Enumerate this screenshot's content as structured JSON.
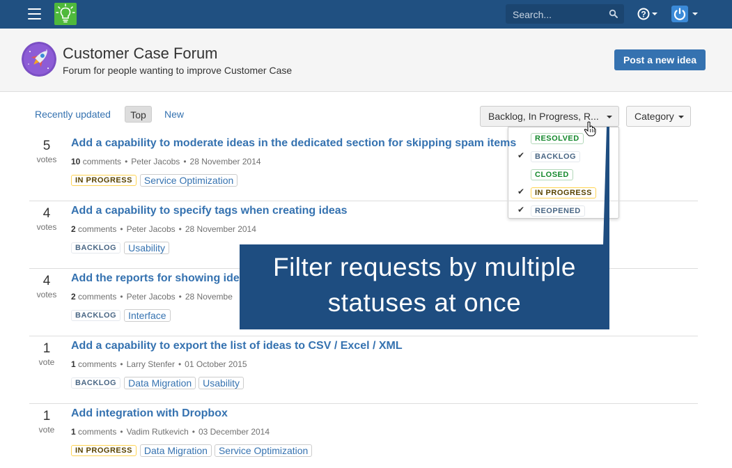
{
  "topbar": {
    "search_placeholder": "Search...",
    "menu_icon": "hamburger-menu-icon",
    "logo_icon": "lightbulb-logo-icon",
    "help_icon": "help-question-icon",
    "user_icon": "power-user-icon",
    "brand_color": "#205081"
  },
  "header": {
    "title": "Customer Case Forum",
    "subtitle": "Forum for people wanting to improve Customer Case",
    "post_button": "Post a new idea",
    "avatar_icon": "rocket-avatar-icon"
  },
  "tabs": {
    "recent": "Recently updated",
    "top": "Top",
    "new": "New",
    "active": "Top"
  },
  "filters": {
    "status_label": "Backlog, In Progress, R...",
    "category_label": "Category"
  },
  "status_dropdown": [
    {
      "label": "RESOLVED",
      "checked": false,
      "color": "green"
    },
    {
      "label": "BACKLOG",
      "checked": true,
      "color": "blue"
    },
    {
      "label": "CLOSED",
      "checked": false,
      "color": "green"
    },
    {
      "label": "IN PROGRESS",
      "checked": true,
      "color": "yellow"
    },
    {
      "label": "REOPENED",
      "checked": true,
      "color": "blue"
    }
  ],
  "check_mark": "✔",
  "ideas": [
    {
      "votes": "5",
      "votes_label": "votes",
      "title": "Add a capability to moderate ideas in the dedicated section for skipping spam items",
      "comments": "10",
      "comments_label": "comments",
      "author": "Peter Jacobs",
      "date": "28 November 2014",
      "status": "IN PROGRESS",
      "status_color": "yellow",
      "tags": [
        "Service Optimization"
      ]
    },
    {
      "votes": "4",
      "votes_label": "votes",
      "title": "Add a capability to specify tags when creating ideas",
      "comments": "2",
      "comments_label": "comments",
      "author": "Peter Jacobs",
      "date": "28 November 2014",
      "status": "BACKLOG",
      "status_color": "blue",
      "tags": [
        "Usability"
      ]
    },
    {
      "votes": "4",
      "votes_label": "votes",
      "title": "Add the reports for showing ide",
      "comments": "2",
      "comments_label": "comments",
      "author": "Peter Jacobs",
      "date": "28 Novembe",
      "status": "BACKLOG",
      "status_color": "blue",
      "tags": [
        "Interface"
      ]
    },
    {
      "votes": "1",
      "votes_label": "vote",
      "title": "Add a capability to export the list of ideas to CSV / Excel / XML",
      "comments": "1",
      "comments_label": "comments",
      "author": "Larry Stenfer",
      "date": "01 October 2015",
      "status": "BACKLOG",
      "status_color": "blue",
      "tags": [
        "Data Migration",
        "Usability"
      ]
    },
    {
      "votes": "1",
      "votes_label": "vote",
      "title": "Add integration with Dropbox",
      "comments": "1",
      "comments_label": "comments",
      "author": "Vadim Rutkevich",
      "date": "03 December 2014",
      "status": "IN PROGRESS",
      "status_color": "yellow",
      "tags": [
        "Data Migration",
        "Service Optimization"
      ]
    }
  ],
  "callout": {
    "line1": "Filter requests by multiple",
    "line2": "statuses  at once",
    "color": "#1e4d80"
  }
}
